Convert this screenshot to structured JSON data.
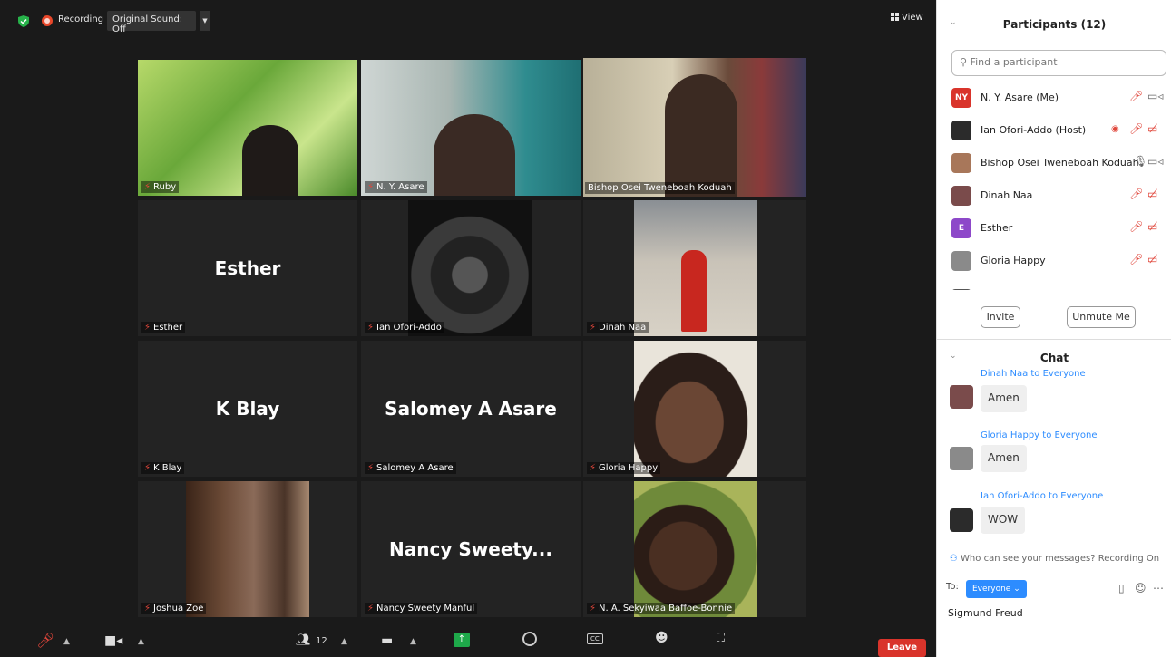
{
  "topbar": {
    "recording_label": "Recording",
    "original_sound": "Original Sound: Off",
    "view_label": "View"
  },
  "tiles": [
    {
      "name": "Ruby",
      "kind": "video",
      "speaking": false
    },
    {
      "name": "N. Y. Asare",
      "kind": "video",
      "speaking": false
    },
    {
      "name": "Bishop Osei Tweneboah Koduah",
      "kind": "video",
      "speaking": true
    },
    {
      "name": "Esther",
      "center": "Esther",
      "kind": "name"
    },
    {
      "name": "Ian Ofori-Addo",
      "kind": "video"
    },
    {
      "name": "Dinah Naa",
      "kind": "video"
    },
    {
      "name": "K Blay",
      "center": "K Blay",
      "kind": "name"
    },
    {
      "name": "Salomey A Asare",
      "center": "Salomey A Asare",
      "kind": "name"
    },
    {
      "name": "Gloria Happy",
      "kind": "video"
    },
    {
      "name": "Joshua Zoe",
      "kind": "video"
    },
    {
      "name": "Nancy Sweety Manful",
      "center": "Nancy  Sweety...",
      "kind": "name"
    },
    {
      "name": "N. A. Sekyiwaa Baffoe-Bonnie",
      "kind": "video"
    }
  ],
  "toolbar": {
    "participants_count": "12",
    "cc_label": "CC",
    "leave_label": "Leave"
  },
  "participants_panel": {
    "title": "Participants (12)",
    "search_placeholder": "Find a participant",
    "participants": [
      {
        "name": "N. Y. Asare (Me)",
        "initials": "NY",
        "avatar_color": "#d9342b"
      },
      {
        "name": "Ian Ofori-Addo (Host)",
        "initials": "",
        "avatar_color": "#2b2b2b"
      },
      {
        "name": "Bishop Osei Tweneboah Koduah",
        "initials": "",
        "avatar_color": "#a8775a"
      },
      {
        "name": "Dinah Naa",
        "initials": "",
        "avatar_color": "#7a4b4b"
      },
      {
        "name": "Esther",
        "initials": "E",
        "avatar_color": "#8d48c9"
      },
      {
        "name": "Gloria Happy",
        "initials": "",
        "avatar_color": "#8a8a8a"
      }
    ],
    "invite_label": "Invite",
    "unmute_label": "Unmute Me"
  },
  "chat_panel": {
    "title": "Chat",
    "messages": [
      {
        "from": "Dinah Naa to Everyone",
        "text": "Amen"
      },
      {
        "from": "Gloria Happy to Everyone",
        "text": "Amen"
      },
      {
        "from": "Ian Ofori-Addo to Everyone",
        "text": "WOW"
      }
    ],
    "who_can_see": "Who can see your messages? Recording On",
    "to_label": "To:",
    "to_target": "Everyone",
    "input_text": "Sigmund Freud"
  }
}
